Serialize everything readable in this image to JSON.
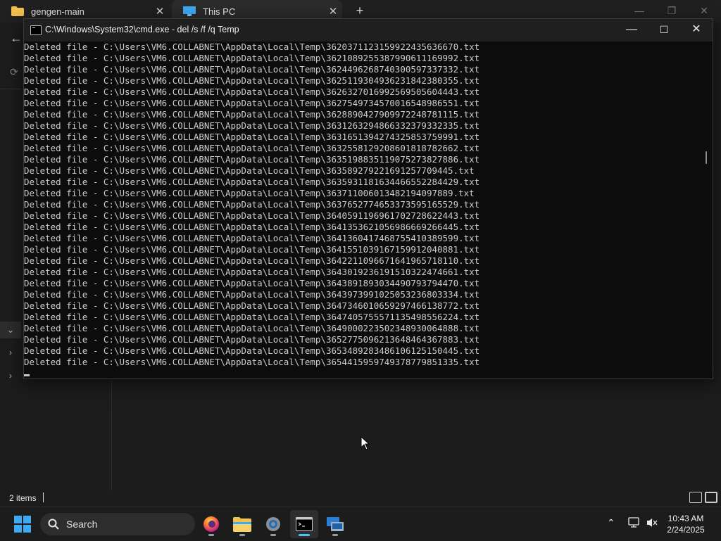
{
  "explorer": {
    "tabs": [
      {
        "label": "gengen-main",
        "icon": "folder-icon"
      },
      {
        "label": "This PC",
        "icon": "monitor-icon"
      }
    ],
    "new_tab": "+",
    "tab_close": "✕",
    "status": {
      "items": "2 items"
    }
  },
  "cmd": {
    "title": "C:\\Windows\\System32\\cmd.exe - del  /s /f /q Temp",
    "controls": {
      "minimize": "—",
      "maximize": "☐",
      "close": "✕"
    },
    "lines": [
      "Deleted file - C:\\Users\\VM6.COLLABNET\\AppData\\Local\\Temp\\3620371123159922435636670.txt",
      "Deleted file - C:\\Users\\VM6.COLLABNET\\AppData\\Local\\Temp\\3621089255387990611169992.txt",
      "Deleted file - C:\\Users\\VM6.COLLABNET\\AppData\\Local\\Temp\\3624496268740300597337332.txt",
      "Deleted file - C:\\Users\\VM6.COLLABNET\\AppData\\Local\\Temp\\3625119304936231842380355.txt",
      "Deleted file - C:\\Users\\VM6.COLLABNET\\AppData\\Local\\Temp\\3626327016992569505604443.txt",
      "Deleted file - C:\\Users\\VM6.COLLABNET\\AppData\\Local\\Temp\\3627549734570016548986551.txt",
      "Deleted file - C:\\Users\\VM6.COLLABNET\\AppData\\Local\\Temp\\3628890427909972248781115.txt",
      "Deleted file - C:\\Users\\VM6.COLLABNET\\AppData\\Local\\Temp\\3631263294866332379332335.txt",
      "Deleted file - C:\\Users\\VM6.COLLABNET\\AppData\\Local\\Temp\\3631651394274325853759991.txt",
      "Deleted file - C:\\Users\\VM6.COLLABNET\\AppData\\Local\\Temp\\3632558129208601818782662.txt",
      "Deleted file - C:\\Users\\VM6.COLLABNET\\AppData\\Local\\Temp\\3635198835119075273827886.txt",
      "Deleted file - C:\\Users\\VM6.COLLABNET\\AppData\\Local\\Temp\\363589279221691257709445.txt",
      "Deleted file - C:\\Users\\VM6.COLLABNET\\AppData\\Local\\Temp\\3635931181634466552284429.txt",
      "Deleted file - C:\\Users\\VM6.COLLABNET\\AppData\\Local\\Temp\\363711006013482194097889.txt",
      "Deleted file - C:\\Users\\VM6.COLLABNET\\AppData\\Local\\Temp\\3637652774653373595165529.txt",
      "Deleted file - C:\\Users\\VM6.COLLABNET\\AppData\\Local\\Temp\\3640591196961702728622443.txt",
      "Deleted file - C:\\Users\\VM6.COLLABNET\\AppData\\Local\\Temp\\3641353621056986669266445.txt",
      "Deleted file - C:\\Users\\VM6.COLLABNET\\AppData\\Local\\Temp\\3641360417468755410389599.txt",
      "Deleted file - C:\\Users\\VM6.COLLABNET\\AppData\\Local\\Temp\\3641551039167159912040881.txt",
      "Deleted file - C:\\Users\\VM6.COLLABNET\\AppData\\Local\\Temp\\3642211096671641965718110.txt",
      "Deleted file - C:\\Users\\VM6.COLLABNET\\AppData\\Local\\Temp\\3643019236191510322474661.txt",
      "Deleted file - C:\\Users\\VM6.COLLABNET\\AppData\\Local\\Temp\\3643891893034490793794470.txt",
      "Deleted file - C:\\Users\\VM6.COLLABNET\\AppData\\Local\\Temp\\3643973991025053236803334.txt",
      "Deleted file - C:\\Users\\VM6.COLLABNET\\AppData\\Local\\Temp\\3647346010659297466138772.txt",
      "Deleted file - C:\\Users\\VM6.COLLABNET\\AppData\\Local\\Temp\\3647405755571135498556224.txt",
      "Deleted file - C:\\Users\\VM6.COLLABNET\\AppData\\Local\\Temp\\3649000223502348930064888.txt",
      "Deleted file - C:\\Users\\VM6.COLLABNET\\AppData\\Local\\Temp\\3652775096213648464367883.txt",
      "Deleted file - C:\\Users\\VM6.COLLABNET\\AppData\\Local\\Temp\\3653489283486106125150445.txt",
      "Deleted file - C:\\Users\\VM6.COLLABNET\\AppData\\Local\\Temp\\3654415959749378779851335.txt"
    ]
  },
  "taskbar": {
    "search_placeholder": "Search",
    "apps": [
      "firefox-icon",
      "file-explorer-icon",
      "settings-icon",
      "terminal-icon",
      "remote-desktop-icon"
    ],
    "clock": {
      "time": "10:43 AM",
      "date": "2/24/2025"
    }
  },
  "colors": {
    "accent": "#4cc2ff",
    "console_text": "#cccccc",
    "console_bg": "#0c0c0c"
  }
}
